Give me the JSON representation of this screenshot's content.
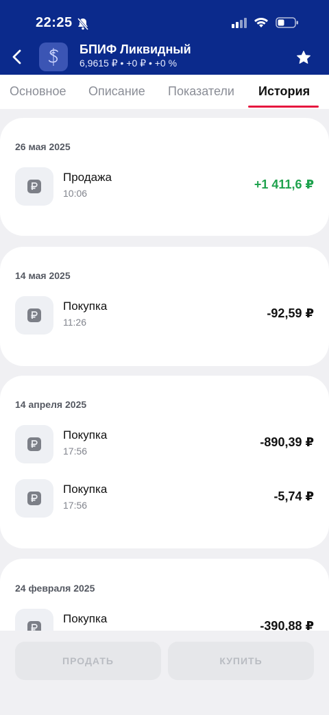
{
  "status_bar": {
    "time": "22:25"
  },
  "header": {
    "title": "БПИФ Ликвидный",
    "subtitle": "6,9615 ₽ • +0 ₽ • +0 %"
  },
  "tabs": [
    {
      "label": "Основное"
    },
    {
      "label": "Описание"
    },
    {
      "label": "Показатели"
    },
    {
      "label": "История",
      "active": true
    }
  ],
  "history": [
    {
      "date": "26 мая 2025",
      "transactions": [
        {
          "title": "Продажа",
          "time": "10:06",
          "amount": "+1 411,6 ₽",
          "positive": true
        }
      ]
    },
    {
      "date": "14 мая 2025",
      "transactions": [
        {
          "title": "Покупка",
          "time": "11:26",
          "amount": "-92,59 ₽"
        }
      ]
    },
    {
      "date": "14 апреля 2025",
      "transactions": [
        {
          "title": "Покупка",
          "time": "17:56",
          "amount": "-890,39 ₽"
        },
        {
          "title": "Покупка",
          "time": "17:56",
          "amount": "-5,74 ₽"
        }
      ]
    },
    {
      "date": "24 февраля 2025",
      "transactions": [
        {
          "title": "Покупка",
          "amount": "-390,88 ₽"
        }
      ]
    }
  ],
  "actions": {
    "sell_label": "ПРОДАТЬ",
    "buy_label": "КУПИТЬ"
  },
  "colors": {
    "header_bg": "#0b2a8c",
    "accent_red": "#e6163e",
    "positive_green": "#1ea24d"
  }
}
